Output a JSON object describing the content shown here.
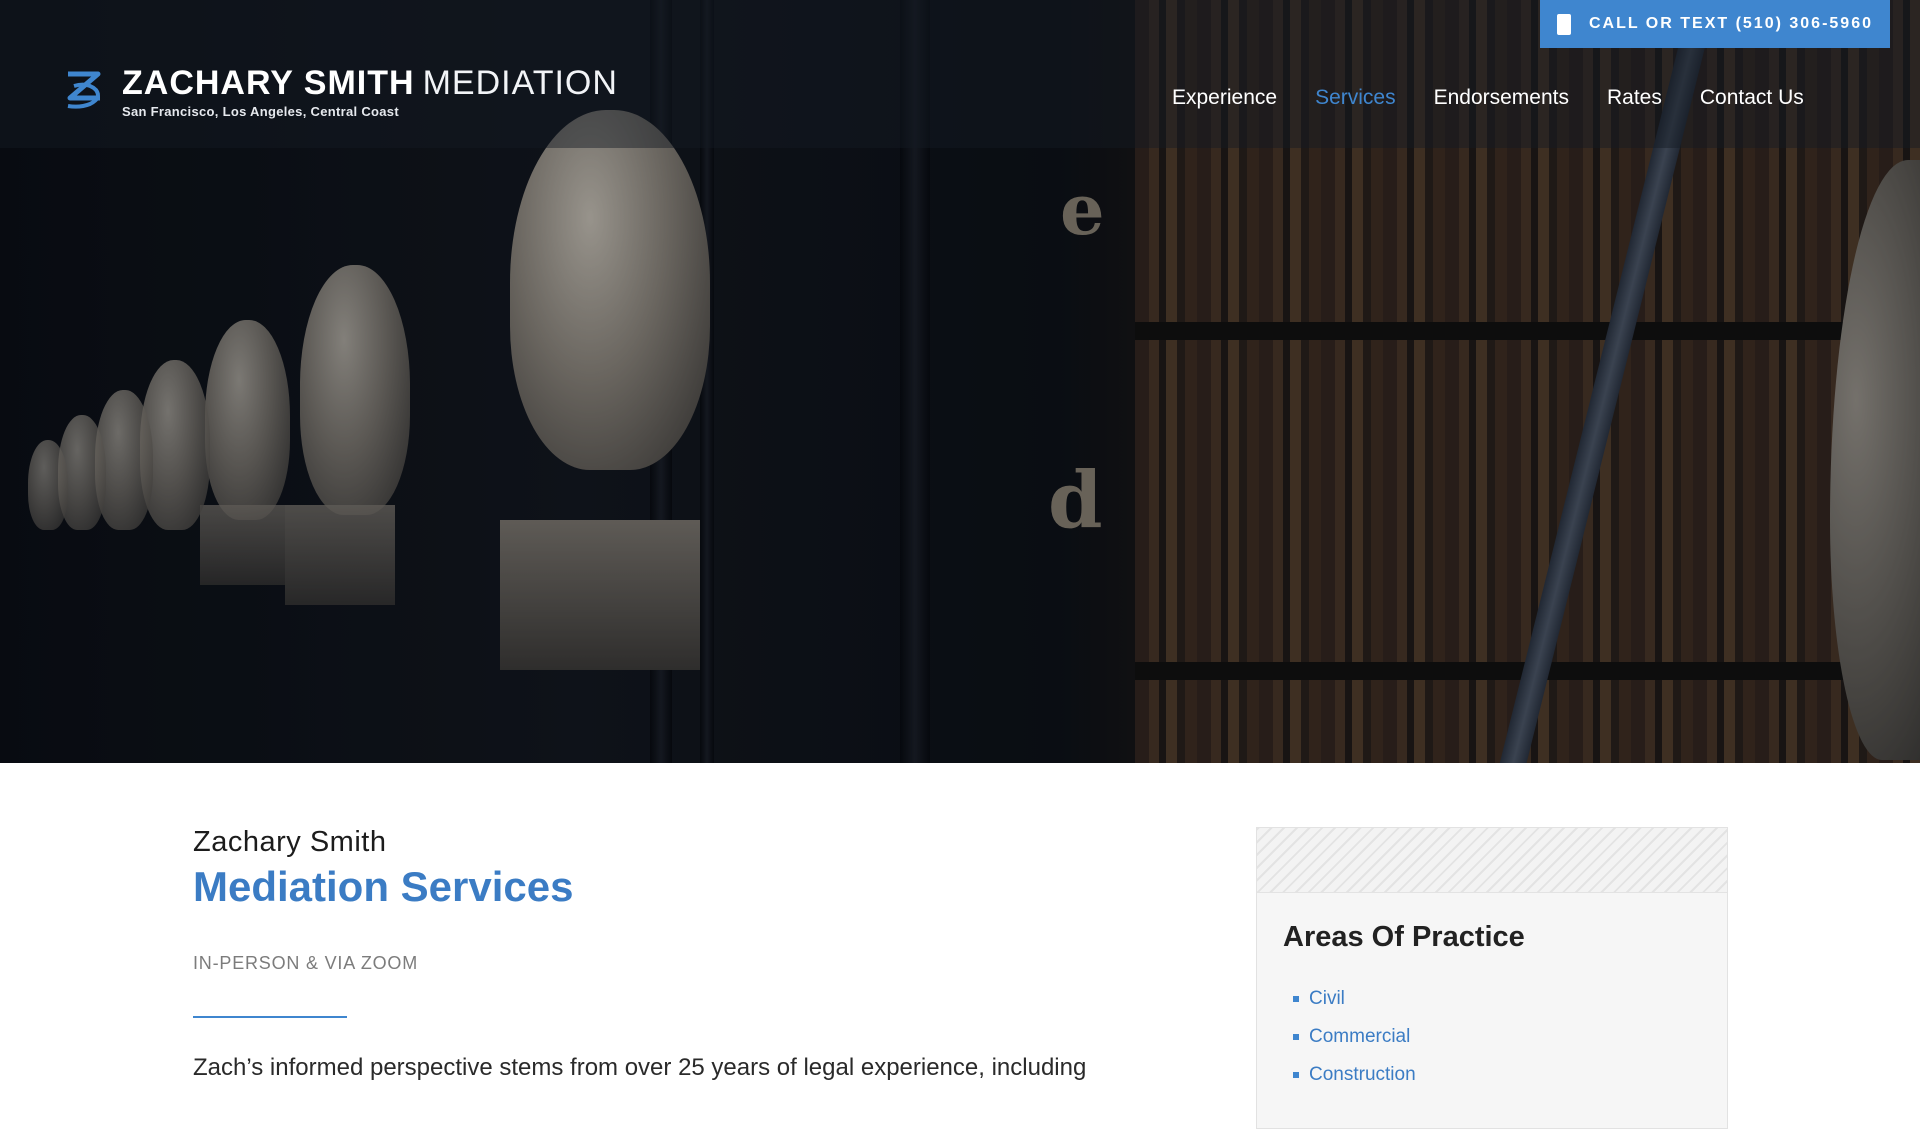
{
  "header": {
    "brand_bold": "ZACHARY SMITH",
    "brand_light": "MEDIATION",
    "brand_locations": "San Francisco, Los Angeles, Central Coast",
    "call_label": "CALL OR TEXT (510) 306-5960"
  },
  "nav": {
    "items": [
      {
        "label": "Experience",
        "active": false
      },
      {
        "label": "Services",
        "active": true
      },
      {
        "label": "Endorsements",
        "active": false
      },
      {
        "label": "Rates",
        "active": false
      },
      {
        "label": "Contact Us",
        "active": false
      }
    ]
  },
  "hero": {
    "shelf_letters": [
      "e",
      "d"
    ]
  },
  "main": {
    "name": "Zachary Smith",
    "title": "Mediation Services",
    "tagline": "IN-PERSON & VIA ZOOM",
    "intro": "Zach’s informed perspective stems from over 25 years of legal experience, including"
  },
  "sidebar": {
    "heading": "Areas Of Practice",
    "items": [
      "Civil",
      "Commercial",
      "Construction"
    ]
  },
  "colors": {
    "accent": "#3f86cf",
    "title_blue": "#3b7cc4"
  }
}
